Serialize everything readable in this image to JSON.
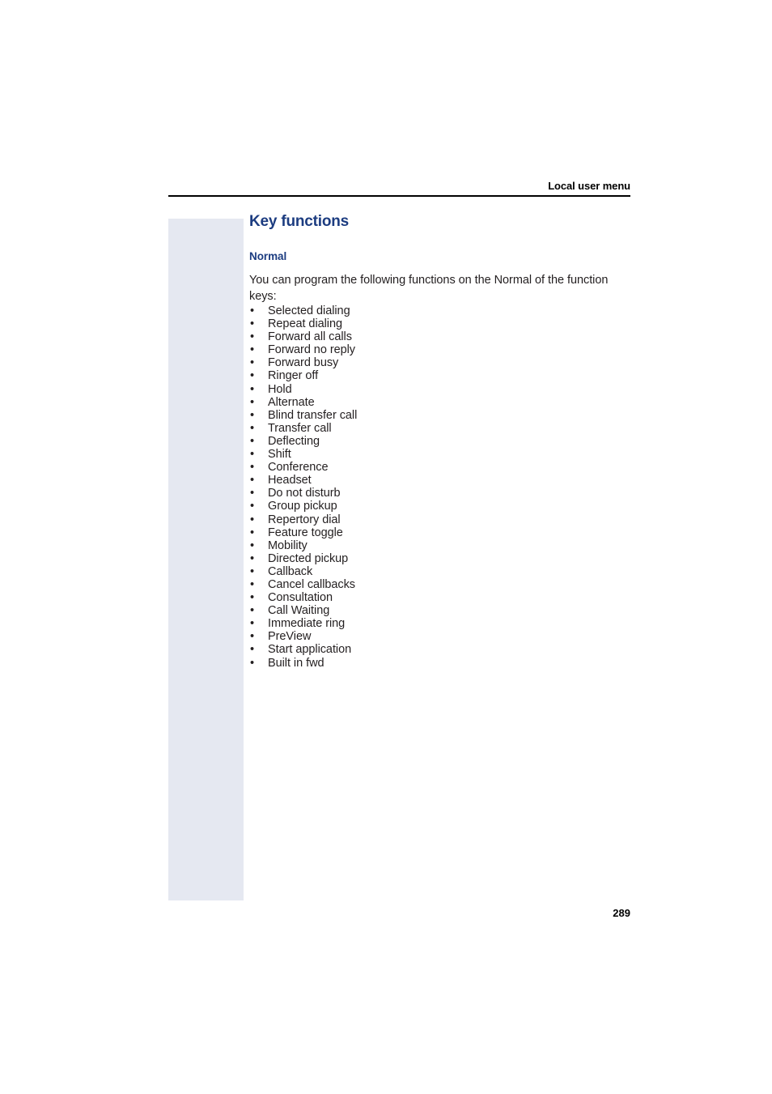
{
  "header": {
    "title": "Local user menu"
  },
  "content": {
    "heading": "Key functions",
    "subheading": "Normal",
    "intro": "You can program the following functions on the Normal of the function keys:",
    "bullet_char": "•",
    "functions": [
      "Selected dialing",
      "Repeat dialing",
      "Forward all calls",
      "Forward no reply",
      "Forward busy",
      "Ringer off",
      "Hold",
      "Alternate",
      "Blind transfer call",
      "Transfer call",
      "Deflecting",
      "Shift",
      "Conference",
      "Headset",
      "Do not disturb",
      "Group pickup",
      "Repertory dial",
      "Feature toggle",
      "Mobility",
      "Directed pickup",
      "Callback",
      "Cancel callbacks",
      "Consultation",
      "Call Waiting",
      "Immediate ring",
      "PreView",
      "Start application",
      "Built in fwd"
    ]
  },
  "footer": {
    "page_number": "289"
  },
  "colors": {
    "heading_blue": "#1c3c80",
    "side_block": "#e5e8f1",
    "body_text": "#231f20",
    "rule": "#000000"
  }
}
